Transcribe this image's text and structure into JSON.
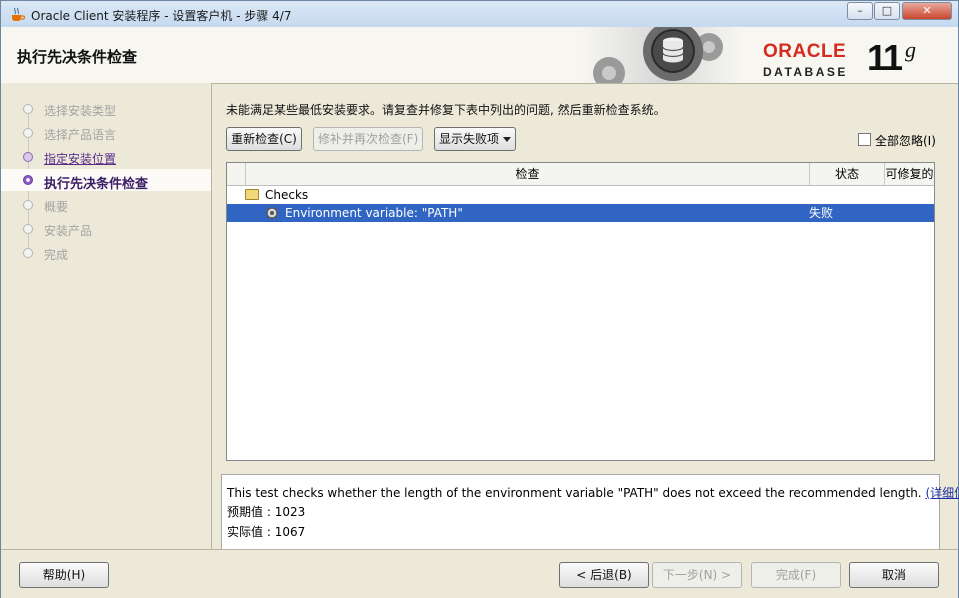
{
  "window": {
    "title": "Oracle Client 安装程序 - 设置客户机 - 步骤 4/7",
    "min_label": "–",
    "max_label": "□",
    "close_label": "✕"
  },
  "header": {
    "title": "执行先决条件检查",
    "brand": "ORACLE",
    "brand_sub": "DATABASE",
    "version_num": "11",
    "version_letter": "g",
    "brand_color": "#d62b1f"
  },
  "sidebar": {
    "steps": [
      {
        "label": "选择安装类型",
        "state": "pending"
      },
      {
        "label": "选择产品语言",
        "state": "pending"
      },
      {
        "label": "指定安装位置",
        "state": "done"
      },
      {
        "label": "执行先决条件检查",
        "state": "current"
      },
      {
        "label": "概要",
        "state": "pending"
      },
      {
        "label": "安装产品",
        "state": "pending"
      },
      {
        "label": "完成",
        "state": "pending"
      }
    ]
  },
  "main": {
    "message": "未能满足某些最低安装要求。请复查并修复下表中列出的问题, 然后重新检查系统。",
    "recheck_label": "重新检查(C)",
    "fix_label": "修补并再次检查(F)",
    "filter_label": "显示失败项",
    "ignore_all_label": "全部忽略(I)",
    "table": {
      "columns": [
        "检查",
        "状态",
        "可修复的"
      ],
      "root": "Checks",
      "rows": [
        {
          "name": "Environment variable: \"PATH\"",
          "status": "失败",
          "fixable": ""
        }
      ]
    },
    "details": {
      "text": "This test checks whether the length of the environment variable \"PATH\" does not exceed the recommended length.",
      "link": "(详细信息)",
      "expected_label": "预期值",
      "expected_value": ": 1023",
      "actual_label": "实际值",
      "actual_value": ": 1067"
    }
  },
  "footer": {
    "help": "帮助(H)",
    "back": "< 后退(B)",
    "next": "下一步(N) >",
    "finish": "完成(F)",
    "cancel": "取消"
  },
  "colors": {
    "selection": "#3165c4",
    "current_step": "#3b1e66"
  }
}
